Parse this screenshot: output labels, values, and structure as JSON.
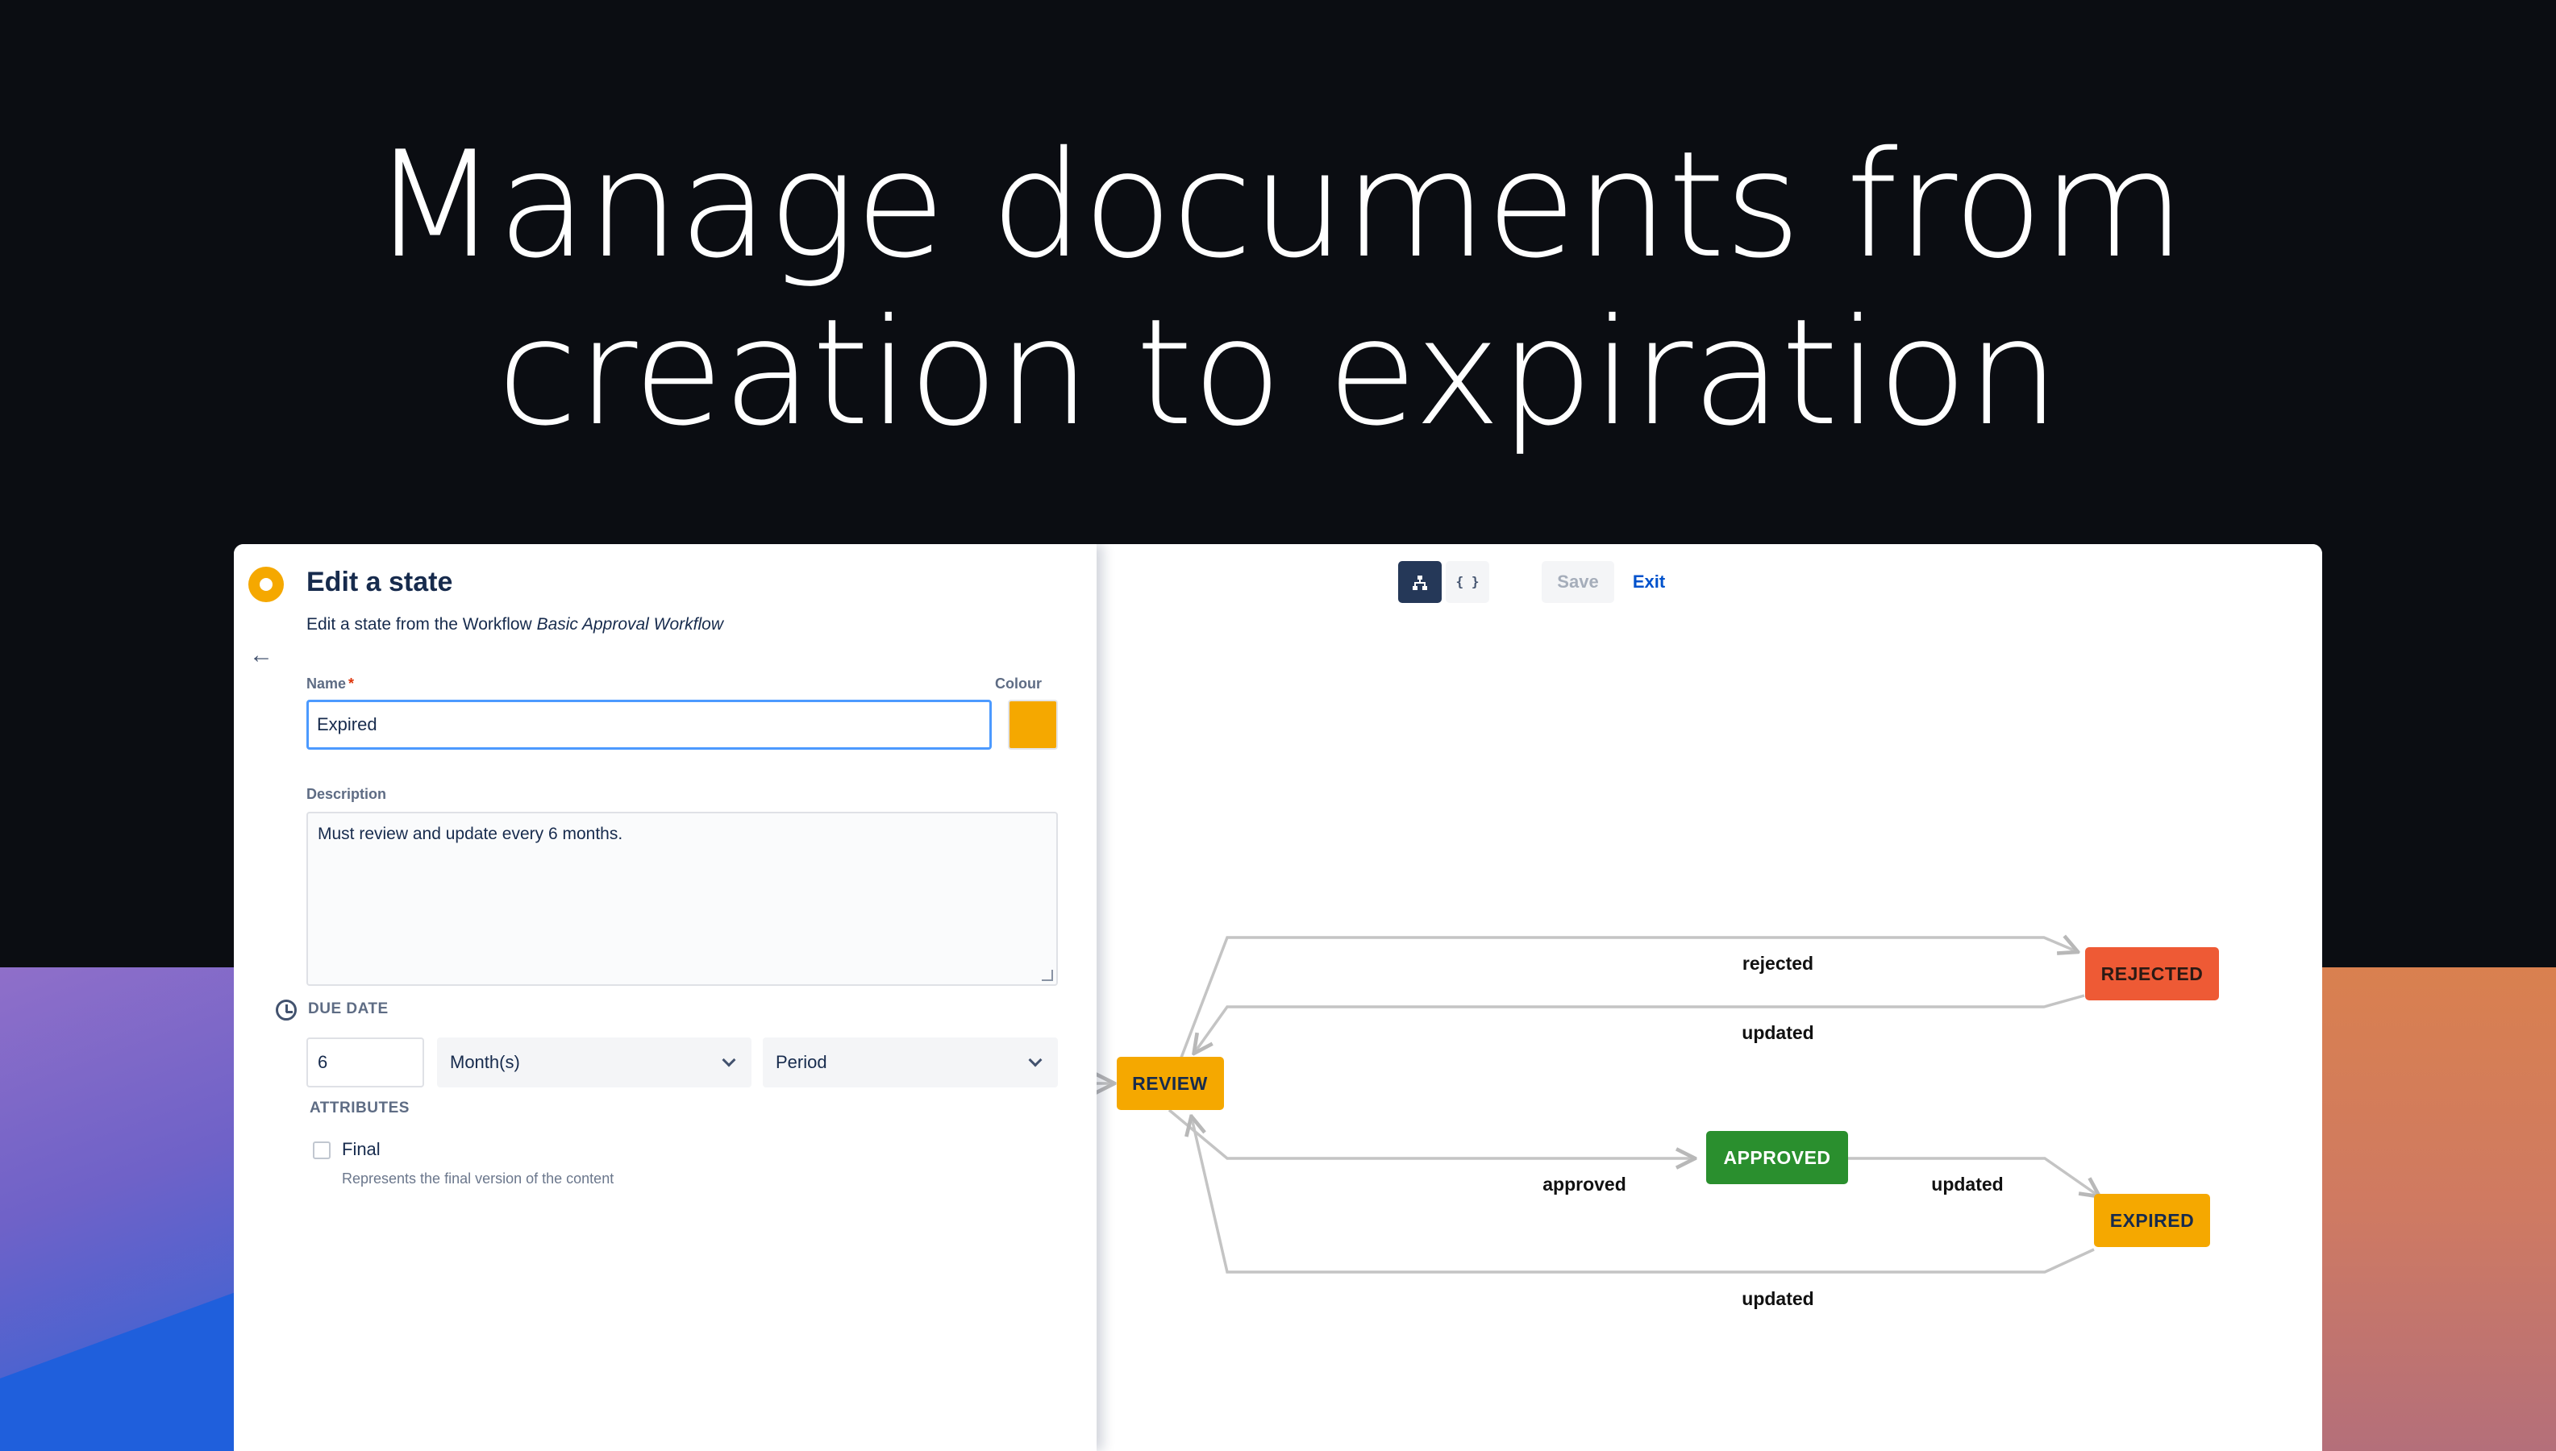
{
  "headline": {
    "line1": "Manage documents from",
    "line2": "creation to expiration"
  },
  "editor": {
    "title": "Edit a state",
    "subtitle_prefix": "Edit a state from the Workflow ",
    "subtitle_workflow": "Basic Approval Workflow",
    "back_icon": "arrow-left-icon",
    "name_label": "Name",
    "required_mark": "*",
    "name_value": "Expired",
    "colour_label": "Colour",
    "colour_value": "#F5A800",
    "description_label": "Description",
    "description_value": "Must review and update every 6 months.",
    "due_date_label": "DUE DATE",
    "due_icon": "clock-icon",
    "due_amount": "6",
    "due_unit": "Month(s)",
    "due_type": "Period",
    "attributes_label": "ATTRIBUTES",
    "final_label": "Final",
    "final_checked": false,
    "final_help": "Represents the final version of the content"
  },
  "toolbar": {
    "diagram_view_icon": "sitemap-icon",
    "json_view_label": "{ }",
    "save_label": "Save",
    "exit_label": "Exit"
  },
  "workflow": {
    "states": {
      "review": {
        "label": "REVIEW",
        "color": "#F5A800"
      },
      "rejected": {
        "label": "REJECTED",
        "color": "#EE5A35"
      },
      "approved": {
        "label": "APPROVED",
        "color": "#2A8F2E"
      },
      "expired": {
        "label": "EXPIRED",
        "color": "#F5A800"
      }
    },
    "transitions": {
      "review_to_rejected": "rejected",
      "rejected_to_review": "updated",
      "review_to_approved": "approved",
      "approved_to_expired": "updated",
      "expired_to_review": "updated"
    }
  }
}
